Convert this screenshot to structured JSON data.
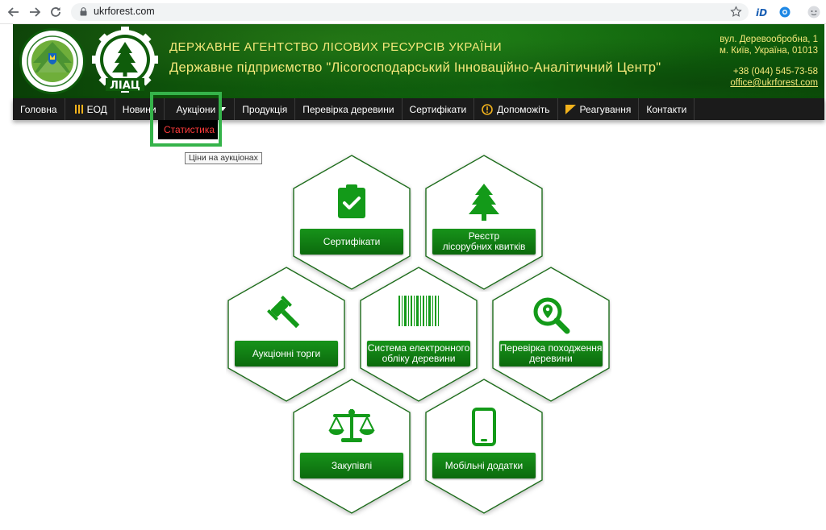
{
  "browser": {
    "url": "ukrforest.com"
  },
  "header": {
    "agency_title": "ДЕРЖАВНЕ АГЕНТСТВО ЛІСОВИХ РЕСУРСІВ УКРАЇНИ",
    "org_title": "Державне підприємство \"Лісогосподарський Інноваційно-Аналітичний Центр\"",
    "logo_text": "ЛІАЦ",
    "address_line1": "вул. Деревообробна, 1",
    "address_line2": "м. Київ, Україна, 01013",
    "phone": "+38 (044) 545-73-58",
    "email": "office@ukrforest.com"
  },
  "menu": {
    "items": [
      {
        "label": "Головна",
        "icon": ""
      },
      {
        "label": "ЕОД",
        "icon": "barcode-icon"
      },
      {
        "label": "Новини",
        "icon": ""
      },
      {
        "label": "Аукціони",
        "icon": "chevron-down-icon"
      },
      {
        "label": "Продукція",
        "icon": ""
      },
      {
        "label": "Перевірка деревини",
        "icon": ""
      },
      {
        "label": "Сертифікати",
        "icon": ""
      },
      {
        "label": "Допоможіть",
        "icon": "alert-circle-icon"
      },
      {
        "label": "Реагування",
        "icon": "flag-icon"
      },
      {
        "label": "Контакти",
        "icon": ""
      }
    ],
    "dropdown_item": "Статистика",
    "tooltip": "Ціни на аукціонах"
  },
  "tiles": [
    {
      "label_1": "Сертифікати",
      "label_2": "",
      "icon": "clipboard-check-icon"
    },
    {
      "label_1": "Реєстр",
      "label_2": "лісорубних квитків",
      "icon": "fir-tree-icon"
    },
    {
      "label_1": "Аукціонні торги",
      "label_2": "",
      "icon": "gavel-icon"
    },
    {
      "label_1": "Система електронного",
      "label_2": "обліку деревини",
      "icon": "barcode-icon"
    },
    {
      "label_1": "Перевірка походження",
      "label_2": "деревини",
      "icon": "magnifier-pin-icon"
    },
    {
      "label_1": "Закупівлі",
      "label_2": "",
      "icon": "scales-icon"
    },
    {
      "label_1": "Мобільні додатки",
      "label_2": "",
      "icon": "smartphone-icon"
    }
  ],
  "colors": {
    "brand_green": "#0f6b0d",
    "header_text": "#f4e77a",
    "menu_bg": "#1b1b1b",
    "dropdown_text": "#ff3b3b",
    "highlight": "#35b34a"
  }
}
